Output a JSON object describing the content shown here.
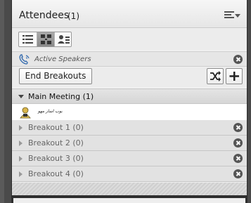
{
  "pod": {
    "title": "Attendees",
    "count": "(1)",
    "menu_icon": "pod-menu-icon"
  },
  "toolbar": {
    "views": [
      {
        "name": "list-view",
        "icon": "list-view-icon",
        "selected": false
      },
      {
        "name": "breakout-view",
        "icon": "breakout-view-icon",
        "selected": true
      },
      {
        "name": "presenter-view",
        "icon": "presenter-view-icon",
        "selected": false
      }
    ]
  },
  "active_speakers": {
    "label": "Active Speakers",
    "icon": "phone-icon"
  },
  "actions": {
    "end_breakouts_label": "End Breakouts",
    "shuffle_icon": "shuffle-icon",
    "add_icon": "add-icon"
  },
  "main_meeting": {
    "label": "Main Meeting (1)",
    "attendee": {
      "name": "یوب اساز مهو",
      "icon": "host-icon"
    }
  },
  "breakouts": [
    {
      "label": "Breakout 1 (0)"
    },
    {
      "label": "Breakout 2 (0)"
    },
    {
      "label": "Breakout 3 (0)"
    },
    {
      "label": "Breakout 4 (0)"
    }
  ],
  "colors": {
    "header_bg": "#eaeaea",
    "row_bg": "#e2e2e2",
    "close_icon": "#555555",
    "frame": "#3b3b3b"
  }
}
